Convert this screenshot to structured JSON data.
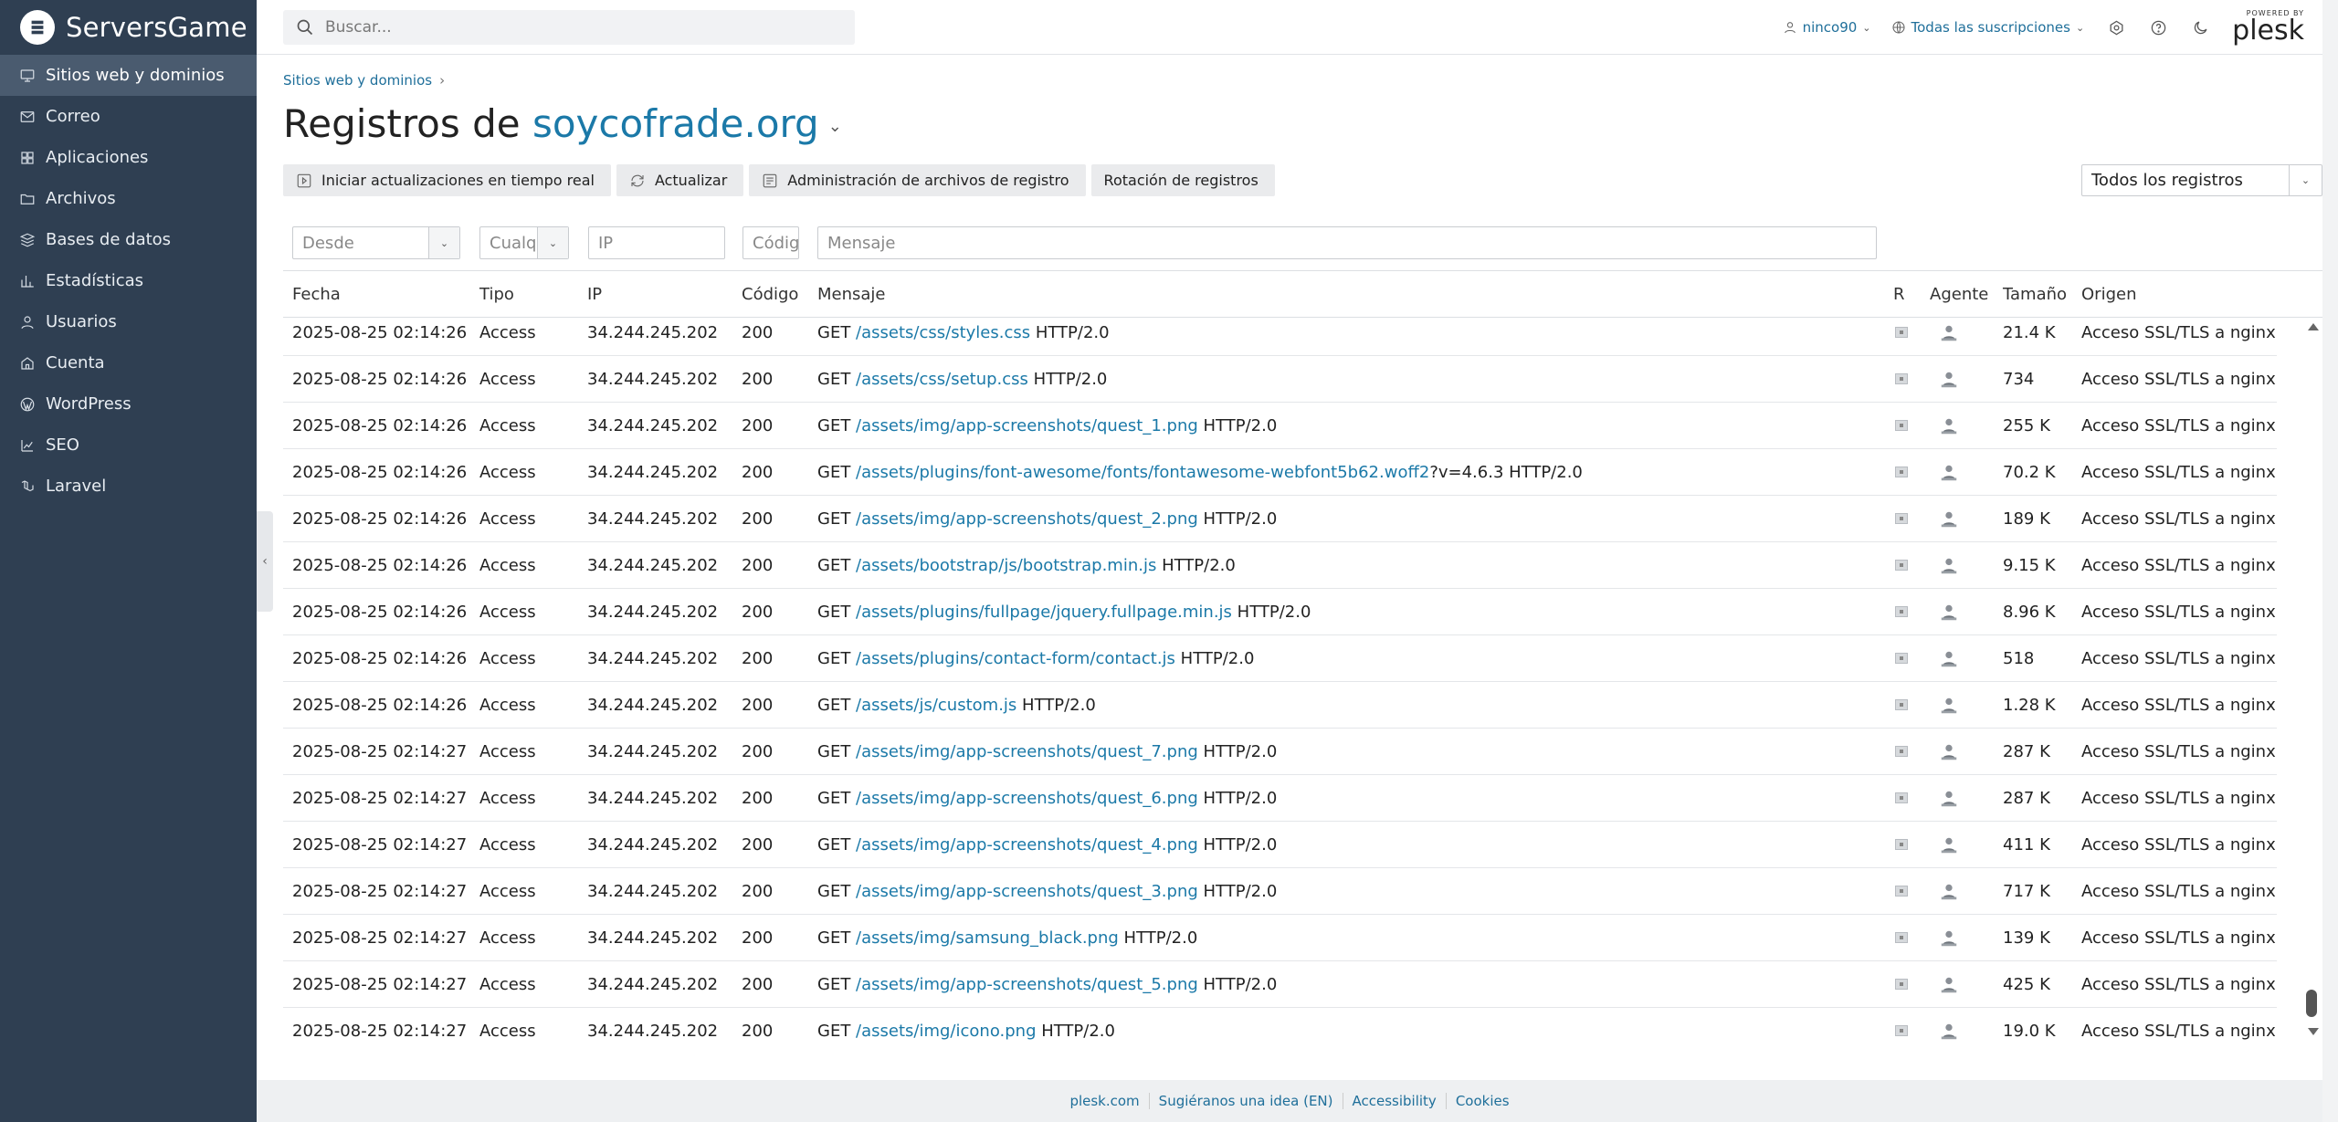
{
  "brand": {
    "name": "ServersGame"
  },
  "sidebar": {
    "items": [
      {
        "label": "Sitios web y dominios",
        "icon": "monitor-icon",
        "active": true
      },
      {
        "label": "Correo",
        "icon": "mail-icon"
      },
      {
        "label": "Aplicaciones",
        "icon": "apps-icon"
      },
      {
        "label": "Archivos",
        "icon": "folder-icon"
      },
      {
        "label": "Bases de datos",
        "icon": "database-icon"
      },
      {
        "label": "Estadísticas",
        "icon": "stats-icon"
      },
      {
        "label": "Usuarios",
        "icon": "user-icon"
      },
      {
        "label": "Cuenta",
        "icon": "account-icon"
      },
      {
        "label": "WordPress",
        "icon": "wordpress-icon"
      },
      {
        "label": "SEO",
        "icon": "seo-icon"
      },
      {
        "label": "Laravel",
        "icon": "laravel-icon"
      }
    ]
  },
  "topbar": {
    "search_placeholder": "Buscar...",
    "user": "ninco90",
    "subscriptions": "Todas las suscripciones",
    "powered_by": "POWERED BY",
    "plesk": "plesk"
  },
  "breadcrumb": {
    "item": "Sitios web y dominios"
  },
  "page": {
    "title_prefix": "Registros de",
    "domain": "soycofrade.org"
  },
  "toolbar": {
    "realtime": "Iniciar actualizaciones en tiempo real",
    "refresh": "Actualizar",
    "logfiles": "Administración de archivos de registro",
    "rotation": "Rotación de registros",
    "log_select": "Todos los registros"
  },
  "filters": {
    "from": "Desde",
    "type": "Cualq",
    "ip": "IP",
    "code": "Códig",
    "message": "Mensaje"
  },
  "table": {
    "headers": [
      "Fecha",
      "Tipo",
      "IP",
      "Código",
      "Mensaje",
      "R",
      "Agente",
      "Tamaño",
      "Origen"
    ],
    "rows": [
      {
        "date": "2025-08-25 02:14:26",
        "type": "Access",
        "ip": "34.244.245.202",
        "code": "200",
        "method": "GET ",
        "path": "/assets/css/styles.css",
        "suffix": " HTTP/2.0",
        "size": "21.4 K",
        "origin": "Acceso SSL/TLS a nginx"
      },
      {
        "date": "2025-08-25 02:14:26",
        "type": "Access",
        "ip": "34.244.245.202",
        "code": "200",
        "method": "GET ",
        "path": "/assets/css/setup.css",
        "suffix": " HTTP/2.0",
        "size": "734",
        "origin": "Acceso SSL/TLS a nginx"
      },
      {
        "date": "2025-08-25 02:14:26",
        "type": "Access",
        "ip": "34.244.245.202",
        "code": "200",
        "method": "GET ",
        "path": "/assets/img/app-screenshots/quest_1.png",
        "suffix": " HTTP/2.0",
        "size": "255 K",
        "origin": "Acceso SSL/TLS a nginx"
      },
      {
        "date": "2025-08-25 02:14:26",
        "type": "Access",
        "ip": "34.244.245.202",
        "code": "200",
        "method": "GET ",
        "path": "/assets/plugins/font-awesome/fonts/fontawesome-webfont5b62.woff2",
        "suffix": "?v=4.6.3 HTTP/2.0",
        "size": "70.2 K",
        "origin": "Acceso SSL/TLS a nginx"
      },
      {
        "date": "2025-08-25 02:14:26",
        "type": "Access",
        "ip": "34.244.245.202",
        "code": "200",
        "method": "GET ",
        "path": "/assets/img/app-screenshots/quest_2.png",
        "suffix": " HTTP/2.0",
        "size": "189 K",
        "origin": "Acceso SSL/TLS a nginx"
      },
      {
        "date": "2025-08-25 02:14:26",
        "type": "Access",
        "ip": "34.244.245.202",
        "code": "200",
        "method": "GET ",
        "path": "/assets/bootstrap/js/bootstrap.min.js",
        "suffix": " HTTP/2.0",
        "size": "9.15 K",
        "origin": "Acceso SSL/TLS a nginx"
      },
      {
        "date": "2025-08-25 02:14:26",
        "type": "Access",
        "ip": "34.244.245.202",
        "code": "200",
        "method": "GET ",
        "path": "/assets/plugins/fullpage/jquery.fullpage.min.js",
        "suffix": " HTTP/2.0",
        "size": "8.96 K",
        "origin": "Acceso SSL/TLS a nginx"
      },
      {
        "date": "2025-08-25 02:14:26",
        "type": "Access",
        "ip": "34.244.245.202",
        "code": "200",
        "method": "GET ",
        "path": "/assets/plugins/contact-form/contact.js",
        "suffix": " HTTP/2.0",
        "size": "518",
        "origin": "Acceso SSL/TLS a nginx"
      },
      {
        "date": "2025-08-25 02:14:26",
        "type": "Access",
        "ip": "34.244.245.202",
        "code": "200",
        "method": "GET ",
        "path": "/assets/js/custom.js",
        "suffix": " HTTP/2.0",
        "size": "1.28 K",
        "origin": "Acceso SSL/TLS a nginx"
      },
      {
        "date": "2025-08-25 02:14:27",
        "type": "Access",
        "ip": "34.244.245.202",
        "code": "200",
        "method": "GET ",
        "path": "/assets/img/app-screenshots/quest_7.png",
        "suffix": " HTTP/2.0",
        "size": "287 K",
        "origin": "Acceso SSL/TLS a nginx"
      },
      {
        "date": "2025-08-25 02:14:27",
        "type": "Access",
        "ip": "34.244.245.202",
        "code": "200",
        "method": "GET ",
        "path": "/assets/img/app-screenshots/quest_6.png",
        "suffix": " HTTP/2.0",
        "size": "287 K",
        "origin": "Acceso SSL/TLS a nginx"
      },
      {
        "date": "2025-08-25 02:14:27",
        "type": "Access",
        "ip": "34.244.245.202",
        "code": "200",
        "method": "GET ",
        "path": "/assets/img/app-screenshots/quest_4.png",
        "suffix": " HTTP/2.0",
        "size": "411 K",
        "origin": "Acceso SSL/TLS a nginx"
      },
      {
        "date": "2025-08-25 02:14:27",
        "type": "Access",
        "ip": "34.244.245.202",
        "code": "200",
        "method": "GET ",
        "path": "/assets/img/app-screenshots/quest_3.png",
        "suffix": " HTTP/2.0",
        "size": "717 K",
        "origin": "Acceso SSL/TLS a nginx"
      },
      {
        "date": "2025-08-25 02:14:27",
        "type": "Access",
        "ip": "34.244.245.202",
        "code": "200",
        "method": "GET ",
        "path": "/assets/img/samsung_black.png",
        "suffix": " HTTP/2.0",
        "size": "139 K",
        "origin": "Acceso SSL/TLS a nginx"
      },
      {
        "date": "2025-08-25 02:14:27",
        "type": "Access",
        "ip": "34.244.245.202",
        "code": "200",
        "method": "GET ",
        "path": "/assets/img/app-screenshots/quest_5.png",
        "suffix": " HTTP/2.0",
        "size": "425 K",
        "origin": "Acceso SSL/TLS a nginx"
      },
      {
        "date": "2025-08-25 02:14:27",
        "type": "Access",
        "ip": "34.244.245.202",
        "code": "200",
        "method": "GET ",
        "path": "/assets/img/icono.png",
        "suffix": " HTTP/2.0",
        "size": "19.0 K",
        "origin": "Acceso SSL/TLS a nginx"
      }
    ]
  },
  "footer": {
    "links": [
      "plesk.com",
      "Sugiéranos una idea (EN)",
      "Accessibility",
      "Cookies"
    ]
  },
  "colors": {
    "sidebar": "#2f3f52",
    "accent": "#1b79a8"
  }
}
